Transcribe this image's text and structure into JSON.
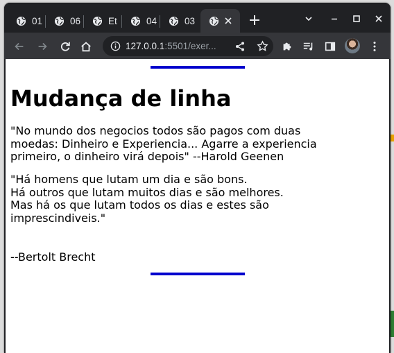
{
  "browser": {
    "tabs": [
      {
        "title": "01",
        "active": false
      },
      {
        "title": "06",
        "active": false
      },
      {
        "title": "Et",
        "active": false
      },
      {
        "title": "04",
        "active": false
      },
      {
        "title": "03",
        "active": false
      },
      {
        "title": "",
        "active": true
      }
    ],
    "new_tab": "+",
    "address": {
      "host": "127.0.0.1",
      "rest": ":5501/exer..."
    }
  },
  "page": {
    "heading": "Mudança de linha",
    "quote1": [
      "\"No mundo dos negocios todos são pagos com duas",
      "moedas: Dinheiro e Experiencia... Agarre a experiencia",
      "primeiro, o dinheiro virá depois\" --Harold Geenen"
    ],
    "quote2": [
      "\"Há homens que lutam um dia e são bons.",
      "Há outros que lutam muitos dias e são melhores.",
      "Mas há os que lutam todos os dias e estes são",
      "imprescindiveis.\""
    ],
    "author": "--Bertolt Brecht"
  },
  "colors": {
    "rule": "#0000cd",
    "chrome_dark": "#202124",
    "chrome_toolbar": "#35363a"
  }
}
